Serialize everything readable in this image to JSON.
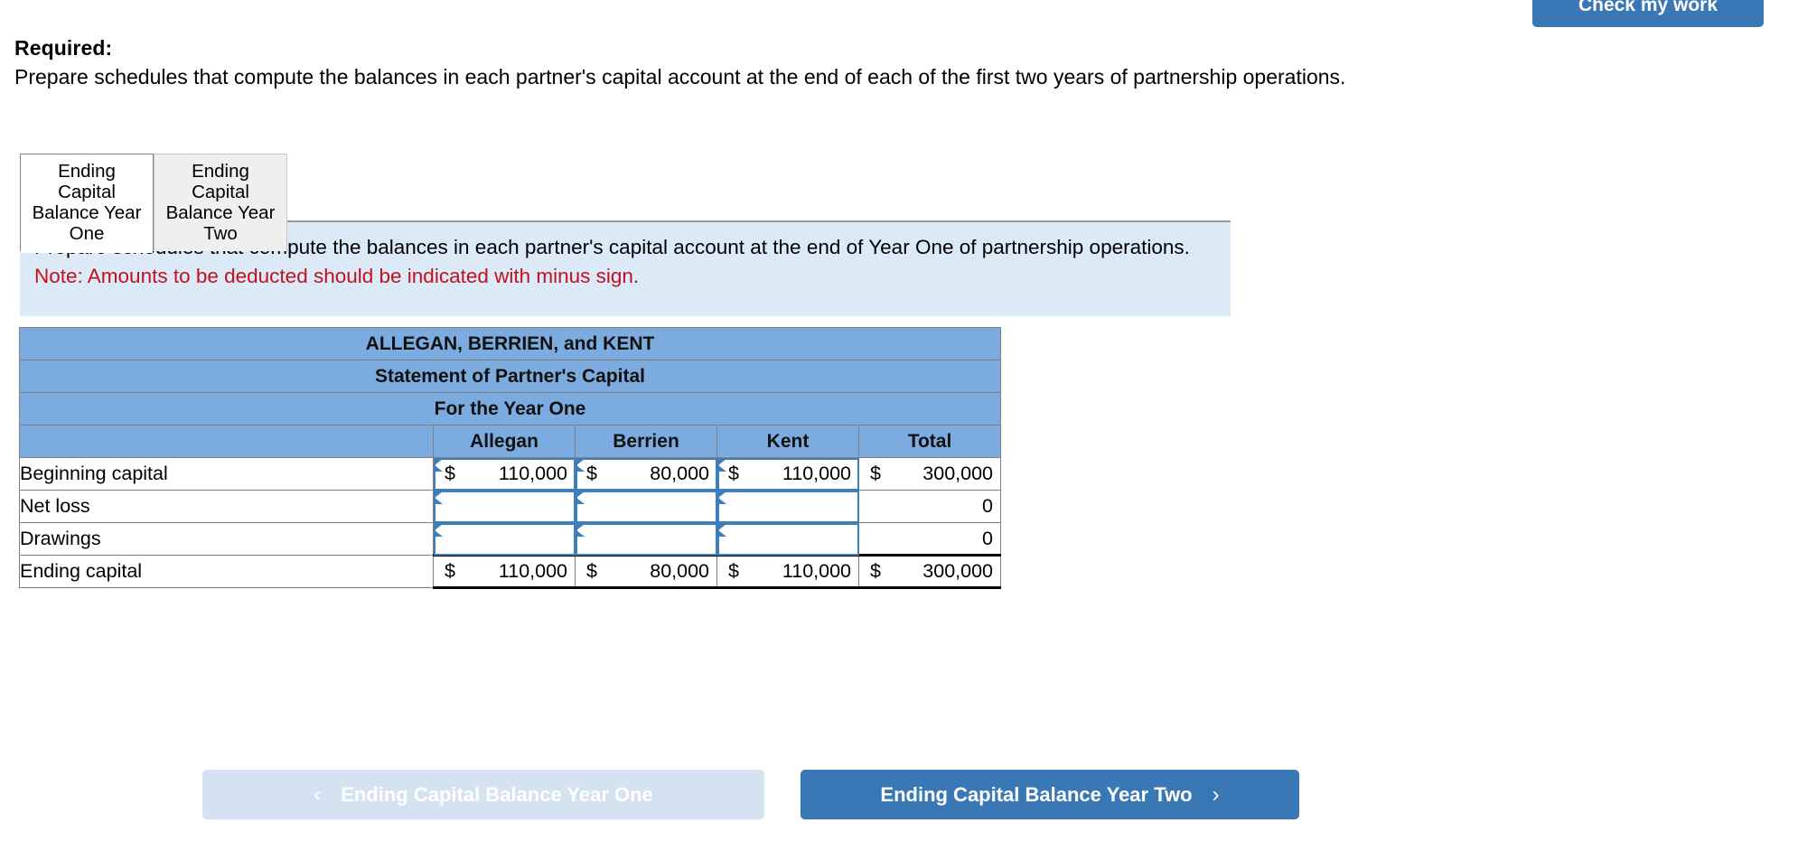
{
  "header": {
    "check_my_work_label": "Check my work"
  },
  "required": {
    "title": "Required:",
    "text": "Prepare schedules that compute the balances in each partner's capital account at the end of each of the first two years of partnership operations."
  },
  "tabs": [
    {
      "label": "Ending Capital Balance Year One",
      "state": "active"
    },
    {
      "label": "Ending Capital Balance Year Two",
      "state": "inactive"
    }
  ],
  "info_panel": {
    "instruction": "Prepare schedules that compute the balances in each partner's capital account at the end of Year One of partnership operations.",
    "note": "Note: Amounts to be deducted should be indicated with minus sign.",
    "background_color": "#dceaf7",
    "note_color": "#c0111f"
  },
  "statement": {
    "title_lines": [
      "ALLEGAN, BERRIEN, and KENT",
      "Statement of Partner's Capital",
      "For the Year One"
    ],
    "column_headers": [
      "",
      "Allegan",
      "Berrien",
      "Kent",
      "Total"
    ],
    "header_color": "#7cacdf",
    "rows": [
      {
        "label": "Beginning capital",
        "indent": false,
        "cells": [
          {
            "currency": "$",
            "value": "110,000",
            "editable": true
          },
          {
            "currency": "$",
            "value": "80,000",
            "editable": true
          },
          {
            "currency": "$",
            "value": "110,000",
            "editable": true
          },
          {
            "currency": "$",
            "value": "300,000",
            "editable": false
          }
        ]
      },
      {
        "label": "Net loss",
        "indent": false,
        "cells": [
          {
            "currency": "",
            "value": "",
            "editable": true
          },
          {
            "currency": "",
            "value": "",
            "editable": true
          },
          {
            "currency": "",
            "value": "",
            "editable": true
          },
          {
            "currency": "",
            "value": "0",
            "editable": false
          }
        ]
      },
      {
        "label": "Drawings",
        "indent": false,
        "cells": [
          {
            "currency": "",
            "value": "",
            "editable": true
          },
          {
            "currency": "",
            "value": "",
            "editable": true
          },
          {
            "currency": "",
            "value": "",
            "editable": true
          },
          {
            "currency": "",
            "value": "0",
            "editable": false
          }
        ]
      },
      {
        "label": "Ending capital",
        "indent": true,
        "total_row": true,
        "cells": [
          {
            "currency": "$",
            "value": "110,000",
            "editable": false
          },
          {
            "currency": "$",
            "value": "80,000",
            "editable": false
          },
          {
            "currency": "$",
            "value": "110,000",
            "editable": false
          },
          {
            "currency": "$",
            "value": "300,000",
            "editable": false
          }
        ]
      }
    ]
  },
  "nav": {
    "prev": {
      "label": "Ending Capital Balance Year One",
      "chevron": "‹",
      "disabled": true
    },
    "next": {
      "label": "Ending Capital Balance Year Two",
      "chevron": "›",
      "disabled": false
    }
  }
}
